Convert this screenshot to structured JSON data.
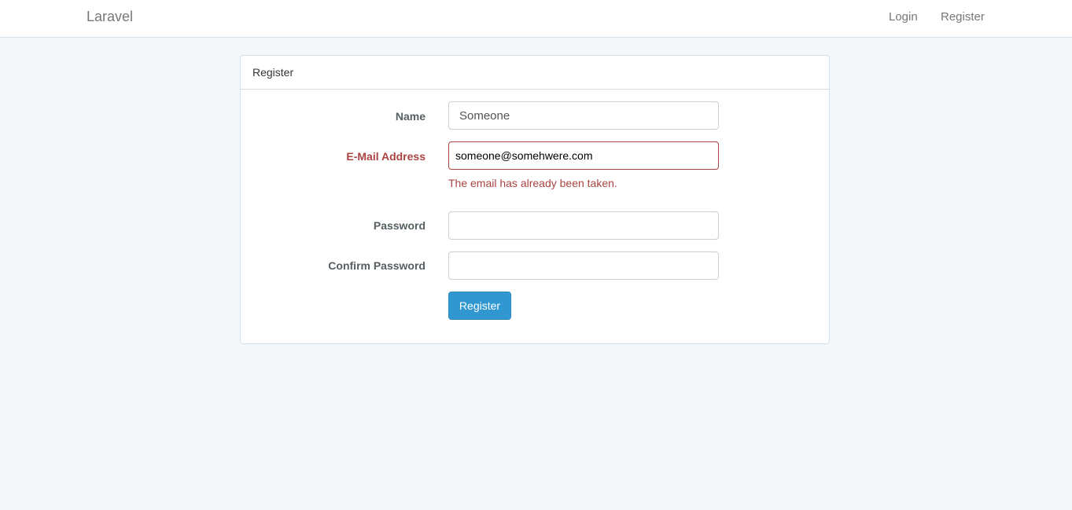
{
  "navbar": {
    "brand": "Laravel",
    "links": {
      "login": "Login",
      "register": "Register"
    }
  },
  "panel": {
    "heading": "Register",
    "fields": {
      "name": {
        "label": "Name",
        "value": "Someone"
      },
      "email": {
        "label": "E-Mail Address",
        "value": "someone@somehwere.com",
        "error": "The email has already been taken."
      },
      "password": {
        "label": "Password",
        "value": ""
      },
      "password_confirmation": {
        "label": "Confirm Password",
        "value": ""
      }
    },
    "submit_label": "Register"
  },
  "colors": {
    "background": "#f5f8fa",
    "primary": "#3097d1",
    "error": "#a94442"
  }
}
